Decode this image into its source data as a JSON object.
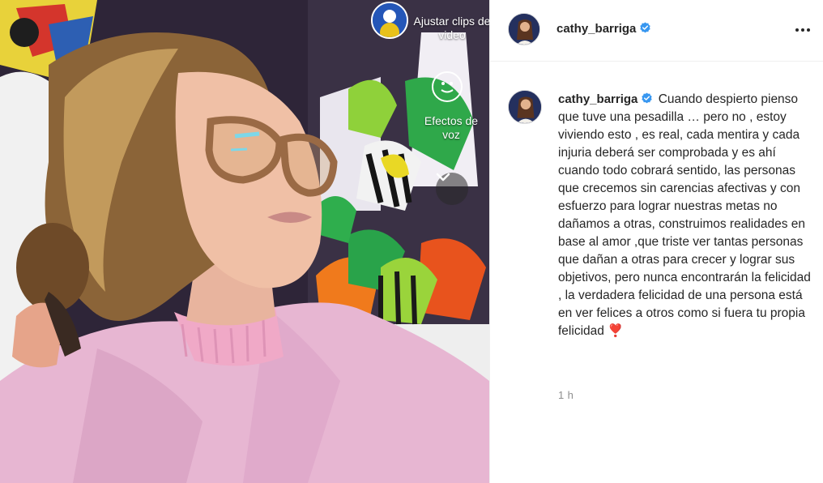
{
  "post": {
    "media": {
      "overlay_adjust_label": "Ajustar clips de video",
      "overlay_effects_label": "Efectos de voz"
    },
    "header": {
      "username": "cathy_barriga",
      "verified": true,
      "more_icon": "more-horizontal-icon"
    },
    "caption": {
      "username": "cathy_barriga",
      "verified": true,
      "text": "Cuando despierto pienso que tuve una pesadilla … pero no , estoy viviendo esto , es real, cada mentira y cada injuria deberá ser comprobada y es ahí cuando todo cobrará sentido, las personas que crecemos sin carencias afectivas y con esfuerzo para lograr nuestras metas no dañamos a otras, construimos realidades en base al amor ,que triste ver tantas personas que dañan a otras para crecer y lograr sus objetivos, pero nunca encontrarán la felicidad , la verdadera felicidad de una persona está en ver felices a otros como si fuera tu propia felicidad",
      "emoji": "❣️"
    },
    "timestamp": "1 h"
  },
  "colors": {
    "verified_blue": "#3897f0",
    "text": "#262626",
    "muted": "#8e8e8e",
    "divider": "#efefef"
  }
}
